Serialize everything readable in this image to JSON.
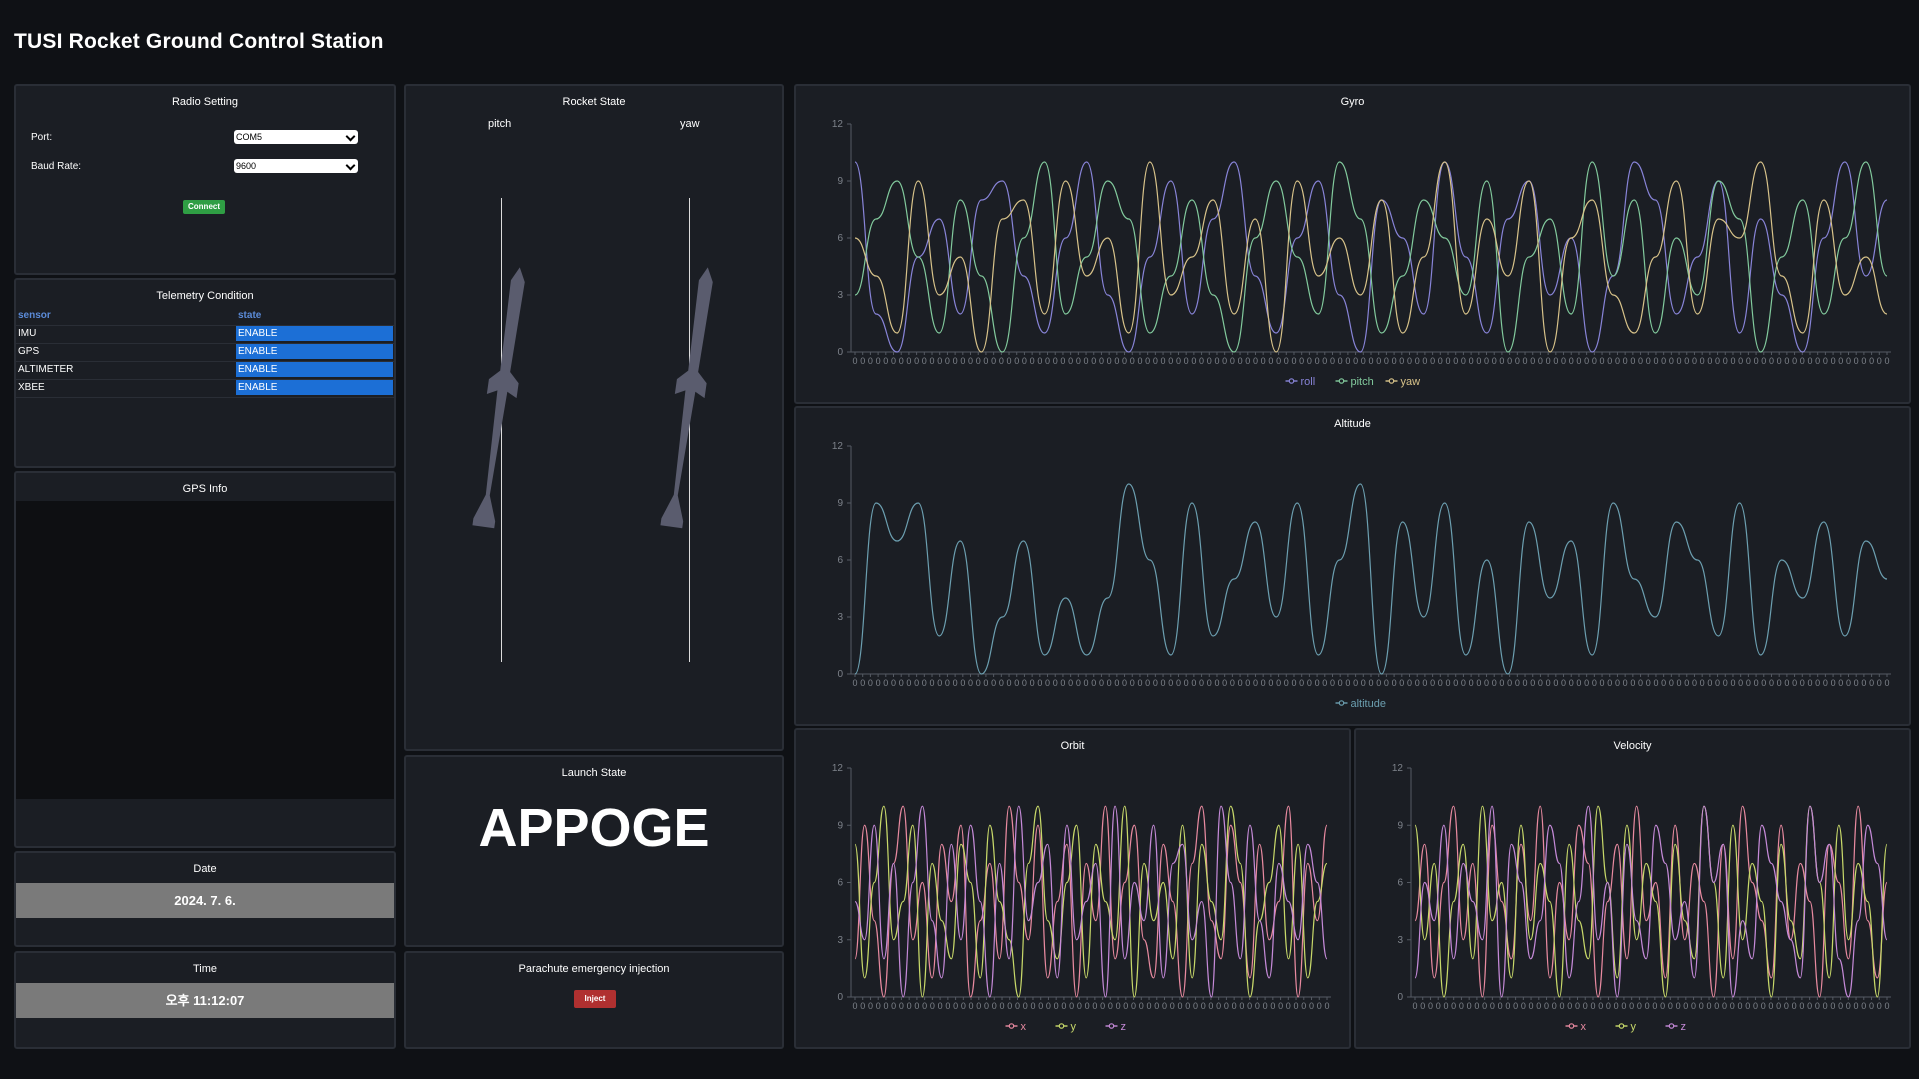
{
  "app": {
    "title": "TUSI Rocket Ground Control Station"
  },
  "radio": {
    "title": "Radio Setting",
    "port_label": "Port:",
    "port_value": "COM5",
    "baud_label": "Baud Rate:",
    "baud_value": "9600",
    "connect_label": "Connect"
  },
  "telemetry": {
    "title": "Telemetry Condition",
    "headers": [
      "sensor",
      "state"
    ],
    "rows": [
      {
        "sensor": "IMU",
        "state": "ENABLE"
      },
      {
        "sensor": "GPS",
        "state": "ENABLE"
      },
      {
        "sensor": "ALTIMETER",
        "state": "ENABLE"
      },
      {
        "sensor": "XBEE",
        "state": "ENABLE"
      }
    ]
  },
  "gps": {
    "title": "GPS Info"
  },
  "date": {
    "title": "Date",
    "value": "2024. 7. 6."
  },
  "time": {
    "title": "Time",
    "value": "오후 11:12:07"
  },
  "rocket_state": {
    "title": "Rocket State",
    "pitch_label": "pitch",
    "yaw_label": "yaw"
  },
  "launch": {
    "title": "Launch State",
    "value": "APPOGE"
  },
  "parachute": {
    "title": "Parachute emergency injection",
    "inject_label": "Inject"
  },
  "colors": {
    "roll": "#8884d8",
    "pitch": "#82ca9d",
    "yaw": "#d8c38a",
    "altitude": "#6c9fb0",
    "x": "#e88aa0",
    "y": "#c8d96a",
    "z": "#c58ad8",
    "connect": "#2f9e44",
    "inject": "#b03030",
    "enable": "#1c6fd6"
  },
  "chart_data": [
    {
      "name_key": "gyro",
      "title": "Gyro",
      "type": "line",
      "ylim": [
        0,
        12
      ],
      "yticks": [
        0,
        3,
        6,
        9,
        12
      ],
      "x_tick_label": "0",
      "legend": [
        "roll",
        "pitch",
        "yaw"
      ],
      "legend_position": "bottom",
      "series": [
        {
          "name": "roll",
          "values": [
            10,
            2,
            0,
            5,
            7,
            2,
            8,
            9,
            4,
            1,
            6,
            10,
            3,
            0,
            5,
            9,
            2,
            7,
            10,
            4,
            1,
            6,
            9,
            3,
            0,
            8,
            6,
            2,
            10,
            5,
            1,
            7,
            9,
            3,
            6,
            0,
            4,
            10,
            8,
            2,
            5,
            9,
            1,
            7,
            3,
            0,
            6,
            10,
            4,
            8
          ]
        },
        {
          "name": "pitch",
          "values": [
            3,
            7,
            9,
            5,
            1,
            8,
            4,
            0,
            6,
            10,
            2,
            5,
            9,
            7,
            1,
            4,
            8,
            3,
            0,
            6,
            9,
            5,
            2,
            10,
            7,
            1,
            4,
            8,
            6,
            3,
            9,
            0,
            5,
            7,
            2,
            10,
            4,
            8,
            1,
            6,
            3,
            9,
            7,
            0,
            5,
            8,
            2,
            6,
            10,
            4
          ]
        },
        {
          "name": "yaw",
          "values": [
            6,
            4,
            1,
            9,
            3,
            5,
            0,
            7,
            8,
            2,
            9,
            4,
            6,
            1,
            10,
            3,
            5,
            8,
            2,
            7,
            0,
            9,
            4,
            6,
            3,
            8,
            1,
            5,
            10,
            2,
            7,
            4,
            9,
            0,
            6,
            8,
            3,
            1,
            5,
            9,
            2,
            7,
            6,
            10,
            4,
            1,
            8,
            3,
            5,
            2
          ]
        }
      ]
    },
    {
      "name_key": "altitude",
      "title": "Altitude",
      "type": "line",
      "ylim": [
        0,
        12
      ],
      "yticks": [
        0,
        3,
        6,
        9,
        12
      ],
      "x_tick_label": "0",
      "legend": [
        "altitude"
      ],
      "legend_position": "bottom",
      "series": [
        {
          "name": "altitude",
          "values": [
            0,
            9,
            7,
            9,
            2,
            7,
            0,
            3,
            7,
            1,
            4,
            1,
            4,
            10,
            6,
            1,
            9,
            2,
            5,
            8,
            3,
            9,
            1,
            6,
            10,
            0,
            8,
            3,
            9,
            1,
            6,
            0,
            8,
            4,
            7,
            1,
            9,
            5,
            3,
            8,
            6,
            2,
            9,
            1,
            6,
            4,
            8,
            2,
            7,
            5
          ]
        }
      ]
    },
    {
      "name_key": "orbit",
      "title": "Orbit",
      "type": "line",
      "ylim": [
        0,
        12
      ],
      "yticks": [
        0,
        3,
        6,
        9,
        12
      ],
      "x_tick_label": "0",
      "legend": [
        "x",
        "y",
        "z"
      ],
      "legend_position": "bottom",
      "series": [
        {
          "name": "x",
          "values": [
            2,
            9,
            4,
            0,
            7,
            10,
            3,
            6,
            1,
            8,
            5,
            9,
            0,
            4,
            7,
            2,
            10,
            6,
            3,
            9,
            1,
            5,
            8,
            0,
            7,
            4,
            10,
            2,
            6,
            9,
            3,
            1,
            8,
            5,
            0,
            7,
            10,
            4,
            2,
            9,
            6,
            1,
            8,
            3,
            5,
            10,
            0,
            7,
            4,
            9
          ]
        },
        {
          "name": "y",
          "values": [
            8,
            1,
            6,
            10,
            3,
            5,
            9,
            0,
            7,
            4,
            2,
            8,
            6,
            1,
            9,
            5,
            3,
            0,
            7,
            10,
            4,
            2,
            6,
            9,
            1,
            8,
            5,
            3,
            10,
            0,
            7,
            4,
            6,
            2,
            9,
            1,
            8,
            5,
            3,
            10,
            7,
            0,
            4,
            6,
            9,
            2,
            8,
            1,
            5,
            7
          ]
        },
        {
          "name": "z",
          "values": [
            5,
            3,
            9,
            2,
            7,
            0,
            6,
            10,
            4,
            1,
            8,
            3,
            9,
            5,
            0,
            7,
            2,
            10,
            4,
            6,
            8,
            1,
            9,
            3,
            5,
            7,
            0,
            10,
            2,
            6,
            4,
            9,
            1,
            7,
            8,
            3,
            5,
            0,
            10,
            6,
            2,
            9,
            4,
            1,
            7,
            5,
            3,
            8,
            6,
            2
          ]
        }
      ]
    },
    {
      "name_key": "velocity",
      "title": "Velocity",
      "type": "line",
      "ylim": [
        0,
        12
      ],
      "yticks": [
        0,
        3,
        6,
        9,
        12
      ],
      "x_tick_label": "0",
      "legend": [
        "x",
        "y",
        "z"
      ],
      "legend_position": "bottom",
      "series": [
        {
          "name": "x",
          "values": [
            4,
            8,
            1,
            6,
            10,
            3,
            7,
            0,
            9,
            5,
            2,
            8,
            4,
            10,
            1,
            6,
            3,
            9,
            7,
            0,
            5,
            8,
            2,
            10,
            4,
            6,
            1,
            9,
            3,
            7,
            5,
            0,
            8,
            2,
            10,
            6,
            4,
            1,
            9,
            3,
            7,
            5,
            0,
            8,
            6,
            2,
            10,
            4,
            1,
            6
          ]
        },
        {
          "name": "y",
          "values": [
            9,
            3,
            7,
            0,
            5,
            8,
            2,
            10,
            4,
            6,
            1,
            9,
            3,
            7,
            5,
            0,
            8,
            4,
            2,
            10,
            6,
            1,
            9,
            3,
            7,
            5,
            0,
            8,
            4,
            2,
            10,
            6,
            1,
            9,
            3,
            7,
            5,
            0,
            8,
            4,
            2,
            10,
            6,
            1,
            9,
            3,
            7,
            5,
            0,
            8
          ]
        },
        {
          "name": "z",
          "values": [
            1,
            6,
            4,
            9,
            2,
            7,
            5,
            3,
            10,
            0,
            8,
            6,
            2,
            4,
            9,
            7,
            1,
            5,
            10,
            3,
            6,
            0,
            8,
            4,
            2,
            9,
            7,
            3,
            5,
            1,
            10,
            6,
            8,
            0,
            4,
            2,
            9,
            7,
            5,
            3,
            1,
            10,
            6,
            8,
            2,
            0,
            4,
            9,
            7,
            3
          ]
        }
      ]
    }
  ]
}
